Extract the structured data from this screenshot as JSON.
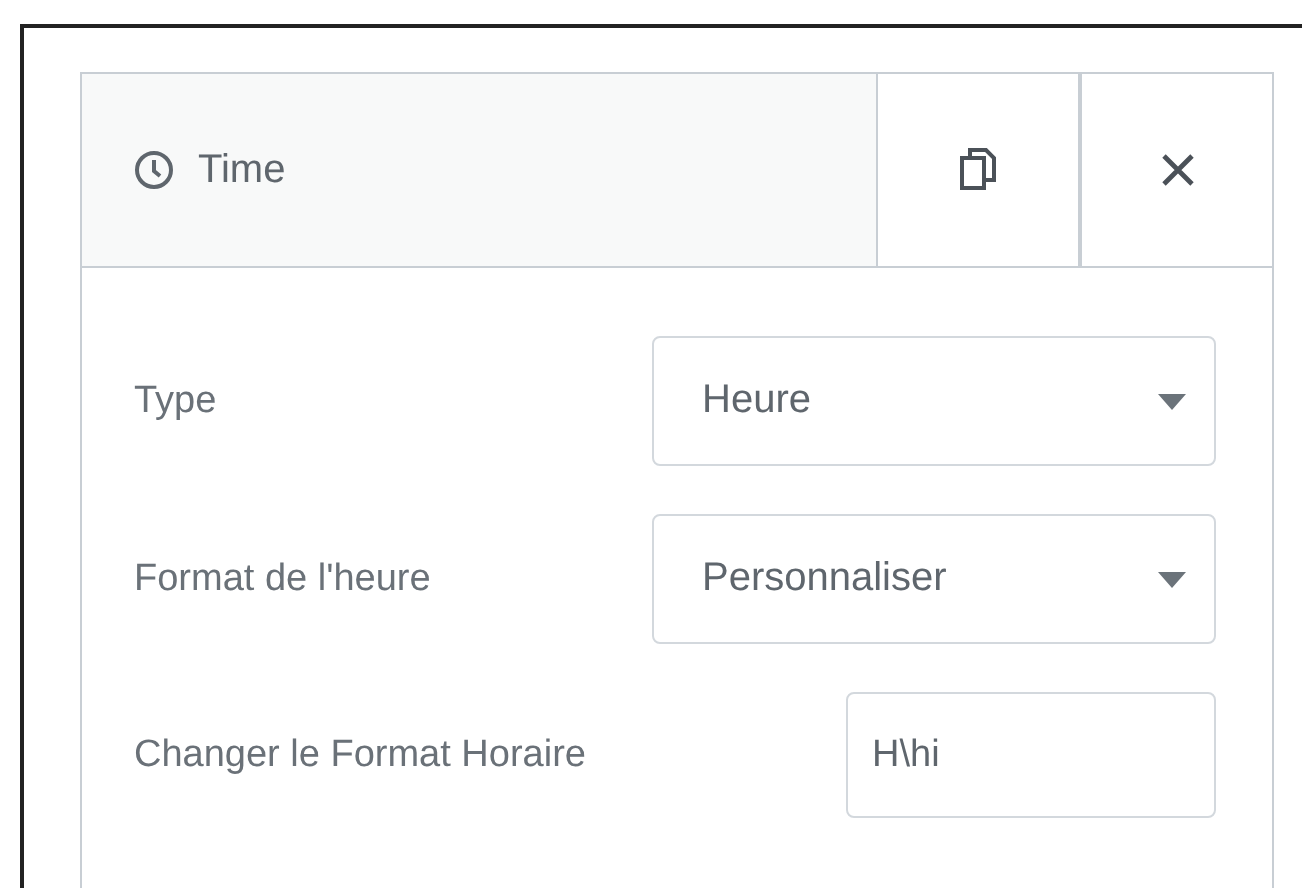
{
  "panel": {
    "title": "Time"
  },
  "fields": [
    {
      "kind": "select",
      "label": "Type",
      "value": "Heure"
    },
    {
      "kind": "select",
      "label": "Format de l'heure",
      "value": "Personnaliser"
    },
    {
      "kind": "text",
      "label": "Changer le Format Horaire",
      "value": "H\\hi"
    }
  ]
}
